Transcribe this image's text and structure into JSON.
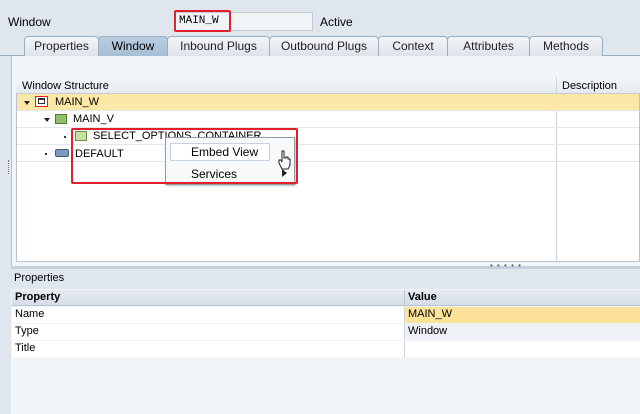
{
  "header": {
    "window_label": "Window",
    "window_name": "MAIN_W",
    "status": "Active"
  },
  "tabs": [
    {
      "label": "Properties"
    },
    {
      "label": "Window"
    },
    {
      "label": "Inbound Plugs"
    },
    {
      "label": "Outbound Plugs"
    },
    {
      "label": "Context"
    },
    {
      "label": "Attributes"
    },
    {
      "label": "Methods"
    }
  ],
  "active_tab": "Window",
  "structure": {
    "col_structure": "Window Structure",
    "col_description": "Description",
    "nodes": [
      {
        "label": "MAIN_W"
      },
      {
        "label": "MAIN_V"
      },
      {
        "label": "SELECT_OPTIONS_CONTAINER"
      },
      {
        "label": "DEFAULT"
      }
    ]
  },
  "context_menu": {
    "items": [
      {
        "label": "Embed View"
      },
      {
        "label": "Services"
      }
    ]
  },
  "properties": {
    "title": "Properties",
    "col_property": "Property",
    "col_value": "Value",
    "rows": [
      {
        "key": "Name",
        "value": "MAIN_W"
      },
      {
        "key": "Type",
        "value": "Window"
      },
      {
        "key": "Title",
        "value": ""
      }
    ]
  },
  "colors": {
    "highlight_red": "#e0202a",
    "selected_row": "#fde8a8",
    "active_tab": "#a7bed4"
  }
}
